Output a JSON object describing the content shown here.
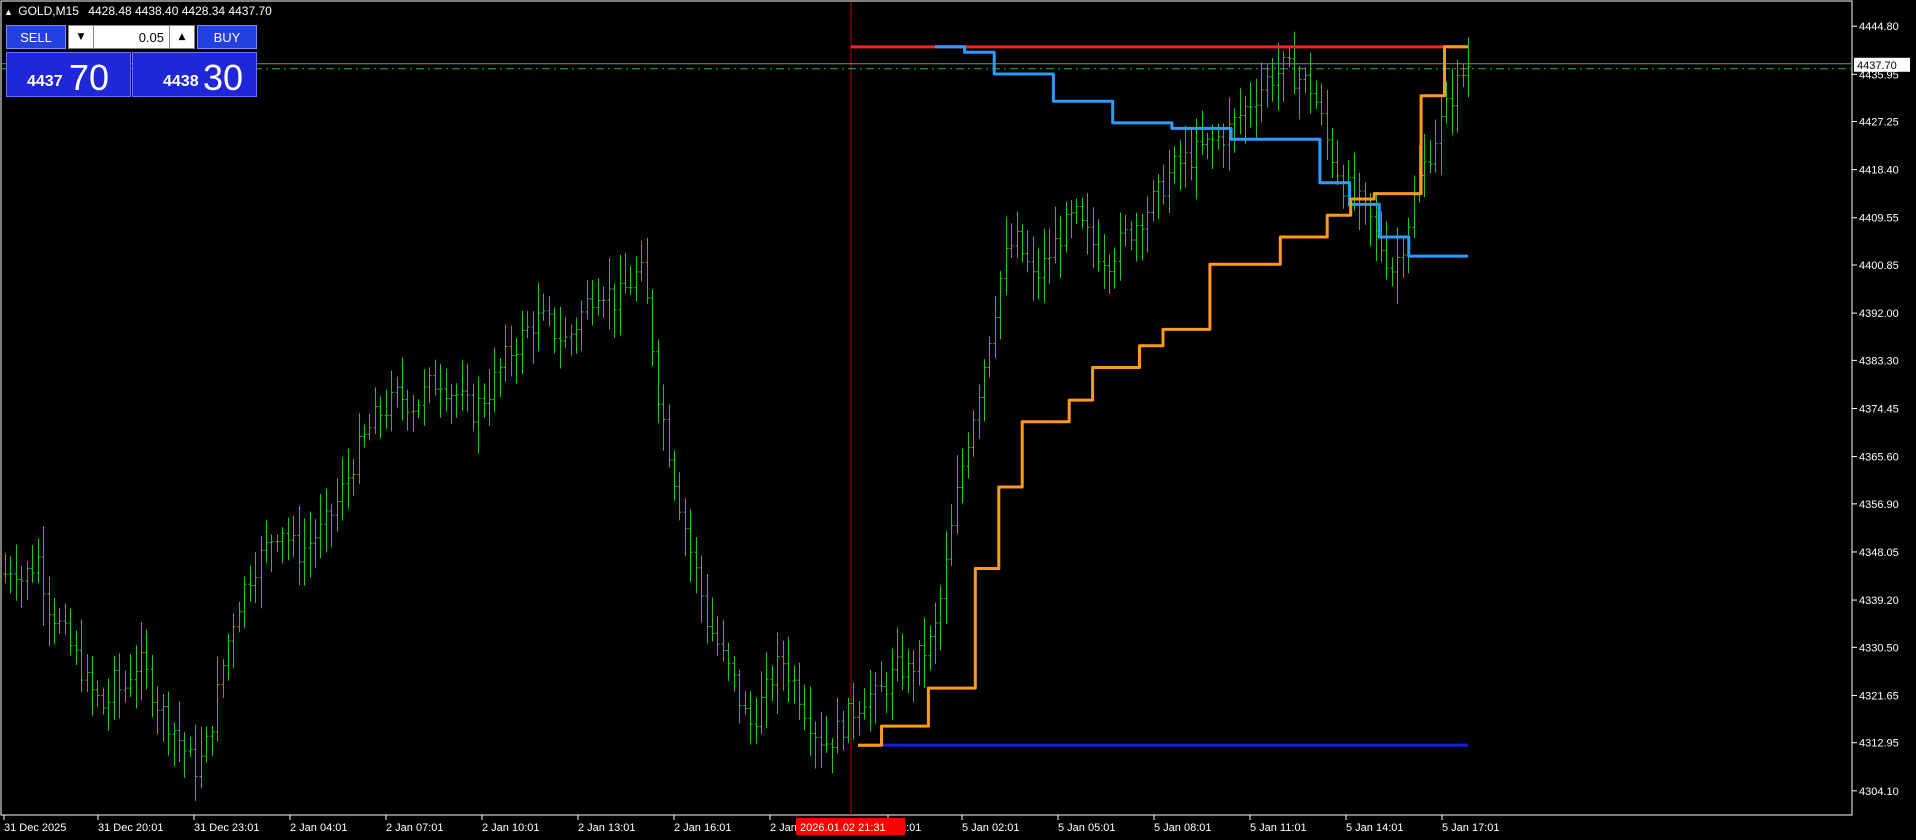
{
  "header": {
    "symbol": "GOLD,M15",
    "ohlc": "4428.48 4438.40 4428.34 4437.70"
  },
  "trade_panel": {
    "sell_label": "SELL",
    "buy_label": "BUY",
    "lot_value": "0.05",
    "sell_price_small": "4437",
    "sell_price_big": "70",
    "buy_price_small": "4438",
    "buy_price_big": "30"
  },
  "colors": {
    "background": "#000000",
    "candles": "#22c322",
    "upper_line": "#ff2020",
    "lower_line": "#1020e0",
    "blue_line": "#2e9bff",
    "orange_line": "#ff9a1f",
    "cursor_line": "#c00000",
    "grid_text": "#ffffff",
    "current_price_line": "#22c322"
  },
  "chart_data": {
    "type": "line",
    "symbol": "GOLD,M15",
    "ylim": [
      4299.65,
      4449.25
    ],
    "y_ticks": [
      4444.8,
      4435.95,
      4427.25,
      4418.4,
      4409.55,
      4400.85,
      4392.0,
      4383.3,
      4374.45,
      4365.6,
      4356.9,
      4348.05,
      4339.2,
      4330.5,
      4321.65,
      4312.95,
      4304.1
    ],
    "x_tick_labels": [
      "31 Dec 2025",
      "31 Dec 20:01",
      "31 Dec 23:01",
      "2 Jan 04:01",
      "2 Jan 07:01",
      "2 Jan 10:01",
      "2 Jan 13:01",
      "2 Jan 16:01",
      "2 Jan",
      "2:01",
      "5 Jan 02:01",
      "5 Jan 05:01",
      "5 Jan 08:01",
      "5 Jan 11:01",
      "5 Jan 14:01",
      "5 Jan 17:01"
    ],
    "cursor_label": "2026.01.02 21:31",
    "current_price": 4437.7,
    "bar_count": 270,
    "closes": [
      4344,
      4346,
      4343,
      4345,
      4347,
      4339,
      4336,
      4333,
      4330,
      4327,
      4323,
      4321,
      4319,
      4324,
      4322,
      4326,
      4328,
      4325,
      4321,
      4318,
      4316,
      4313,
      4310,
      4308,
      4312,
      4319,
      4327,
      4334,
      4339,
      4343,
      4346,
      4348,
      4351,
      4353,
      4350,
      4348,
      4349,
      4351,
      4352,
      4355,
      4358,
      4362,
      4366,
      4369,
      4372,
      4374,
      4375,
      4377,
      4376,
      4375,
      4377,
      4379,
      4380,
      4378,
      4377,
      4375,
      4374,
      4376,
      4378,
      4381,
      4384,
      4386,
      4388,
      4390,
      4391,
      4390,
      4388,
      4387,
      4389,
      4392,
      4395,
      4397,
      4396,
      4394,
      4396,
      4398,
      4400,
      4392,
      4378,
      4370,
      4362,
      4355,
      4348,
      4342,
      4335,
      4332,
      4328,
      4325,
      4320,
      4316,
      4319,
      4322,
      4326,
      4328,
      4325,
      4322,
      4318,
      4315,
      4313,
      4314,
      4316,
      4318,
      4320,
      4322,
      4321,
      4323,
      4325,
      4327,
      4326,
      4328,
      4330,
      4332,
      4340,
      4350,
      4360,
      4368,
      4375,
      4382,
      4390,
      4398,
      4404,
      4405,
      4402,
      4398,
      4400,
      4403,
      4406,
      4408,
      4410,
      4407,
      4405,
      4403,
      4402,
      4404,
      4406,
      4408,
      4410,
      4412,
      4414,
      4417,
      4419,
      4420,
      4421,
      4422,
      4423,
      4424,
      4425,
      4427,
      4429,
      4431,
      4433,
      4435,
      4436,
      4437,
      4436,
      4435,
      4434,
      4430,
      4424,
      4420,
      4416,
      4414,
      4412,
      4410,
      4406,
      4403,
      4400,
      4404,
      4410,
      4416,
      4420,
      4424,
      4428,
      4432,
      4435,
      4437.7
    ],
    "series": [
      {
        "values": [
          4441,
          4441
        ]
      },
      {
        "values": [
          4312.5,
          4312.5
        ]
      },
      {
        "values": [
          4441,
          4440,
          4436,
          4436,
          4431,
          4431,
          4427,
          4427,
          4426,
          4426,
          4424,
          4424,
          4424,
          4416,
          4412,
          4406,
          4402.5,
          4402.5
        ]
      },
      {
        "values": [
          4312.5,
          4316,
          4316,
          4323,
          4323,
          4345,
          4360,
          4372,
          4372,
          4376,
          4382,
          4382,
          4386,
          4389,
          4389,
          4401,
          4401,
          4401,
          4406,
          4406,
          4410,
          4413,
          4414,
          4414,
          4432,
          4441
        ]
      }
    ]
  }
}
